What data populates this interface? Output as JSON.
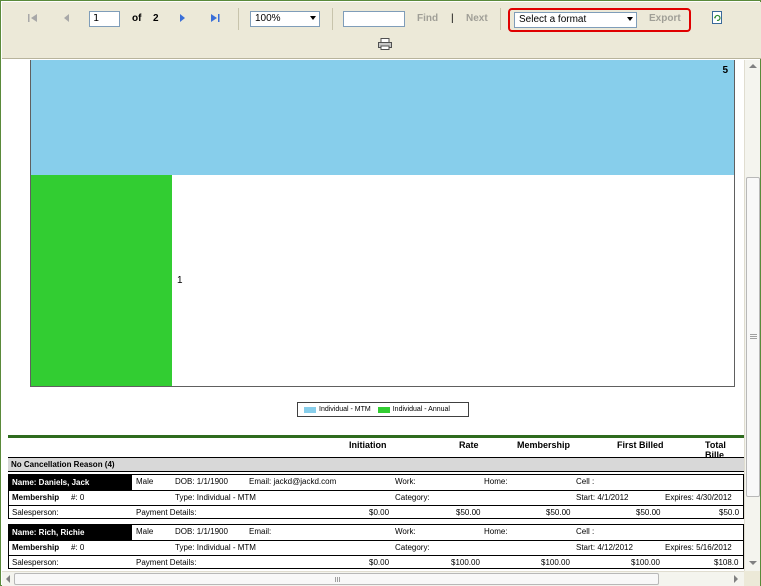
{
  "toolbar": {
    "page_current": "1",
    "page_of_label": "of",
    "page_total": "2",
    "zoom_value": "100%",
    "find_value": "",
    "find_label": "Find",
    "separator": "|",
    "next_label": "Next",
    "format_value": "Select a format",
    "export_label": "Export",
    "icons": [
      "first-page-icon",
      "previous-page-icon",
      "next-page-icon",
      "last-page-icon",
      "refresh-icon",
      "print-icon"
    ]
  },
  "chart_data": {
    "type": "bar",
    "orientation": "horizontal",
    "series": [
      {
        "name": "Individual - MTM",
        "values": [
          5
        ],
        "color": "#87ceeb"
      },
      {
        "name": "Individual - Annual",
        "values": [
          1
        ],
        "color": "#32cd32"
      }
    ],
    "xlim": [
      0,
      5
    ],
    "data_labels": [
      "5",
      "1"
    ],
    "legend_position": "bottom-center"
  },
  "report": {
    "columns": [
      "Initiation",
      "Rate",
      "Membership",
      "First Billed",
      "Total Bille"
    ],
    "group_label": "No Cancellation Reason (4)",
    "members": [
      {
        "name": "Name: Daniels, Jack",
        "gender": "Male",
        "dob": "DOB: 1/1/1900",
        "email": "Email: jackd@jackd.com",
        "work": "Work:",
        "home": "Home:",
        "cell": "Cell :",
        "membership_label": "Membership",
        "membership_no": "#: 0",
        "type": "Type: Individual - MTM",
        "category": "Category:",
        "start": "Start: 4/1/2012",
        "expires": "Expires: 4/30/2012",
        "salesperson": "Salesperson:",
        "payment_details": "Payment Details:",
        "initiation": "$0.00",
        "rate": "$50.00",
        "membership": "$50.00",
        "first_billed": "$50.00",
        "total_billed": "$50.0"
      },
      {
        "name": "Name: Rich, Richie",
        "gender": "Male",
        "dob": "DOB: 1/1/1900",
        "email": "Email:",
        "work": "Work:",
        "home": "Home:",
        "cell": "Cell :",
        "membership_label": "Membership",
        "membership_no": "#: 0",
        "type": "Type: Individual - MTM",
        "category": "Category:",
        "start": "Start: 4/12/2012",
        "expires": "Expires: 5/16/2012",
        "salesperson": "Salesperson:",
        "payment_details": "Payment Details:",
        "initiation": "$0.00",
        "rate": "$100.00",
        "membership": "$100.00",
        "first_billed": "$100.00",
        "total_billed": "$108.0"
      }
    ]
  },
  "scrollbar_grip": "III"
}
